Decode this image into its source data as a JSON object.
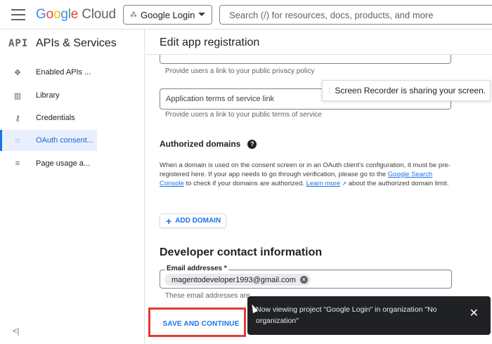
{
  "header": {
    "logo_letters": [
      "G",
      "o",
      "o",
      "g",
      "l",
      "e"
    ],
    "logo_product": "Cloud",
    "project_name": "Google Login",
    "search_placeholder": "Search (/) for resources, docs, products, and more"
  },
  "sidebar": {
    "api_label": "API",
    "title": "APIs & Services",
    "items": [
      {
        "label": "Enabled APIs ...",
        "icon": "diamond-dots-icon",
        "glyph": "✥"
      },
      {
        "label": "Library",
        "icon": "library-icon",
        "glyph": "▥"
      },
      {
        "label": "Credentials",
        "icon": "key-icon",
        "glyph": "⚷"
      },
      {
        "label": "OAuth consent...",
        "icon": "consent-screen-icon",
        "glyph": "⁙",
        "active": true
      },
      {
        "label": "Page usage a...",
        "icon": "settings-list-icon",
        "glyph": "≡"
      }
    ],
    "collapse_glyph": "<|"
  },
  "main": {
    "page_title": "Edit app registration",
    "privacy_helper": "Provide users a link to your public privacy policy",
    "terms_field_placeholder": "Application terms of service link",
    "terms_helper": "Provide users a link to your public terms of service",
    "authorized_domains_title": "Authorized domains",
    "authorized_domains_text_1": "When a domain is used on the consent screen or in an OAuth client's configuration, it must be pre-registered here. If your app needs to go through verification, please go to the ",
    "authorized_domains_link_1": "Google Search Console",
    "authorized_domains_text_2": " to check if your domains are authorized. ",
    "authorized_domains_link_2": "Learn more",
    "authorized_domains_text_3": " about the authorized domain limit.",
    "add_domain_label": "ADD DOMAIN",
    "developer_contact_title": "Developer contact information",
    "email_label": "Email addresses *",
    "email_chip": "magentodeveloper1993@gmail.com",
    "email_helper": "These email addresses are for Google to notify you about any changes to your project.",
    "save_label": "SAVE AND CONTINUE"
  },
  "notifications": {
    "screen_recorder": "Screen Recorder is sharing your screen.",
    "snackbar_message": "Now viewing project \"Google Login\" in organization \"No organization\"",
    "snackbar_close": "✕"
  },
  "colors": {
    "accent": "#1a73e8",
    "highlight_border": "#e53935",
    "snackbar_bg": "#202124"
  }
}
